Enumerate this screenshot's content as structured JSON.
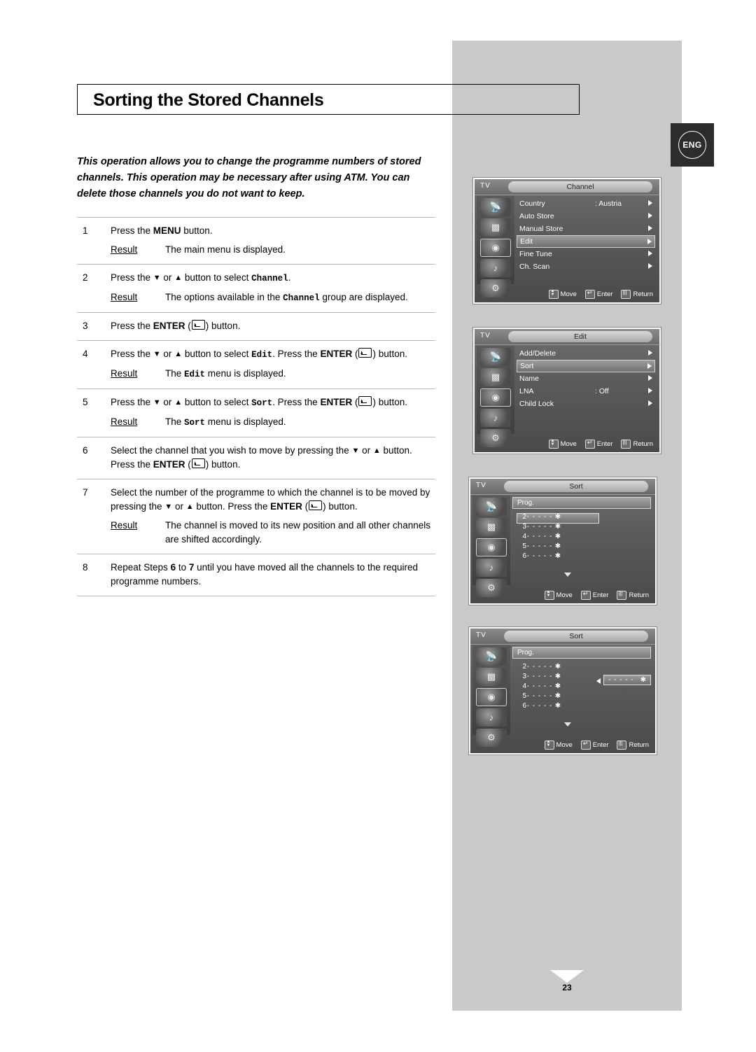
{
  "page": {
    "title": "Sorting the Stored Channels",
    "eng_badge": "ENG",
    "number": "23",
    "intro": "This operation allows you to change the programme numbers of stored channels. This operation may be necessary after using ATM. You can delete those channels you do not want to keep."
  },
  "steps": [
    {
      "num": "1",
      "text_pre": "Press the ",
      "text_bold": "MENU",
      "text_post": " button.",
      "result_label": "Result",
      "result_text": "The main menu is displayed."
    },
    {
      "num": "2",
      "text_a": "Press the ",
      "text_b": " or ",
      "text_c": " button to select ",
      "mono": "Channel",
      "text_d": ".",
      "result_label": "Result",
      "result_a": "The options available in the ",
      "result_mono": "Channel",
      "result_b": " group are displayed."
    },
    {
      "num": "3",
      "text_a": "Press the ",
      "bold": "ENTER",
      "text_b": " (",
      "text_c": ") button."
    },
    {
      "num": "4",
      "text_a": "Press the ",
      "text_b": " or ",
      "text_c": " button to select ",
      "mono": "Edit",
      "text_d": ". Press the ",
      "bold": "ENTER",
      "text_e": " (",
      "text_f": ") button.",
      "result_label": "Result",
      "result_a": "The ",
      "result_mono": "Edit",
      "result_b": " menu is displayed."
    },
    {
      "num": "5",
      "text_a": "Press the ",
      "text_b": " or ",
      "text_c": " button to select ",
      "mono": "Sort",
      "text_d": ". Press the ",
      "bold": "ENTER",
      "text_e": " (",
      "text_f": ") button.",
      "result_label": "Result",
      "result_a": "The ",
      "result_mono": "Sort",
      "result_b": " menu is displayed."
    },
    {
      "num": "6",
      "text_a": "Select the channel that you wish to move by pressing the ",
      "text_b": " or ",
      "text_c": " button. Press the ",
      "bold": "ENTER",
      "text_d": " (",
      "text_e": ") button."
    },
    {
      "num": "7",
      "text_a": "Select the number of the programme to which the channel is to be moved by pressing the ",
      "text_b": " or ",
      "text_c": " button. Press the ",
      "bold": "ENTER",
      "text_d": " (",
      "text_e": ") button.",
      "result_label": "Result",
      "result_text": "The channel is moved to its new position and all other channels are shifted accordingly."
    },
    {
      "num": "8",
      "text_a": "Repeat Steps ",
      "bold_a": "6",
      "text_b": " to ",
      "bold_b": "7",
      "text_c": " until you have moved all the channels to the required programme numbers."
    }
  ],
  "osd": {
    "tv_label": "TV",
    "footer": {
      "move": "Move",
      "enter": "Enter",
      "return": "Return"
    },
    "channel_menu": {
      "title": "Channel",
      "rows": [
        {
          "name": "Country",
          "value": ": Austria",
          "highlight": false
        },
        {
          "name": "Auto Store",
          "value": "",
          "highlight": false
        },
        {
          "name": "Manual Store",
          "value": "",
          "highlight": false
        },
        {
          "name": "Edit",
          "value": "",
          "highlight": true
        },
        {
          "name": "Fine Tune",
          "value": "",
          "highlight": false
        },
        {
          "name": "Ch. Scan",
          "value": "",
          "highlight": false
        }
      ]
    },
    "edit_menu": {
      "title": "Edit",
      "rows": [
        {
          "name": "Add/Delete",
          "value": "",
          "highlight": false
        },
        {
          "name": "Sort",
          "value": "",
          "highlight": true
        },
        {
          "name": "Name",
          "value": "",
          "highlight": false
        },
        {
          "name": "LNA",
          "value": ": Off",
          "highlight": false
        },
        {
          "name": "Child Lock",
          "value": "",
          "highlight": false
        }
      ]
    },
    "sort_menu_1": {
      "title": "Sort",
      "prog_label": "Prog.",
      "rows": [
        {
          "n": "2",
          "dash": "- - - - -",
          "star": "✱"
        },
        {
          "n": "3",
          "dash": "- - - - -",
          "star": "✱"
        },
        {
          "n": "4",
          "dash": "- - - - -",
          "star": "✱"
        },
        {
          "n": "5",
          "dash": "- - - - -",
          "star": "✱"
        },
        {
          "n": "6",
          "dash": "- - - - -",
          "star": "✱"
        }
      ]
    },
    "sort_menu_2": {
      "title": "Sort",
      "prog_label": "Prog.",
      "rows": [
        {
          "n": "2",
          "dash": "- - - - -",
          "star": "✱"
        },
        {
          "n": "3",
          "dash": "- - - - -",
          "star": "✱"
        },
        {
          "n": "4",
          "dash": "- - - - -",
          "star": "✱"
        },
        {
          "n": "5",
          "dash": "- - - - -",
          "star": "✱"
        },
        {
          "n": "6",
          "dash": "- - - - -",
          "star": "✱"
        }
      ],
      "moved_dash": "- - - - -",
      "moved_star": "✱"
    }
  }
}
